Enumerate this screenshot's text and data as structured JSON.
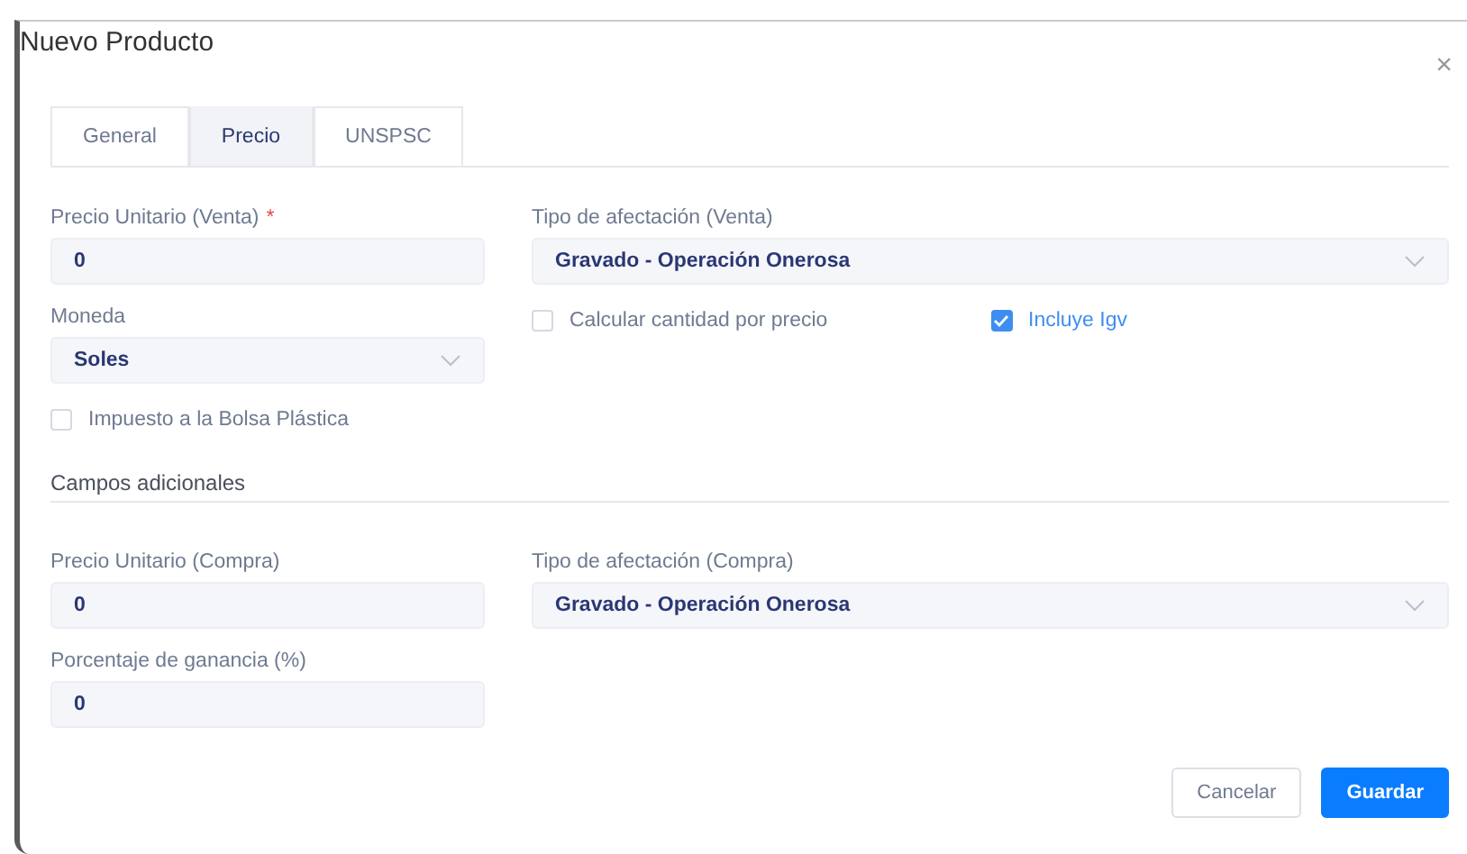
{
  "dialog": {
    "title": "Nuevo Producto",
    "close": "×"
  },
  "tabs": [
    {
      "label": "General",
      "selected": false
    },
    {
      "label": "Precio",
      "selected": true
    },
    {
      "label": "UNSPSC",
      "selected": false
    }
  ],
  "main_rows": [
    [
      {
        "kind": "input",
        "label": "Precio Unitario (Venta)",
        "required_mark": "*",
        "value": "0"
      },
      {
        "kind": "select",
        "label": "Tipo de afectación (Venta)",
        "value": "Gravado - Operación Onerosa"
      }
    ],
    [
      {
        "kind": "select",
        "label": "Moneda",
        "value": "Soles"
      },
      {
        "kind": "checks",
        "items": [
          {
            "label": "Calcular cantidad por precio",
            "checked": false
          },
          {
            "label": "Incluye Igv",
            "checked": true
          }
        ]
      }
    ],
    [
      {
        "kind": "checks",
        "items": [
          {
            "label": "Impuesto a la Bolsa Plástica",
            "checked": false
          }
        ]
      }
    ]
  ],
  "section_title": "Campos adicionales",
  "extra_rows": [
    [
      {
        "kind": "input",
        "label": "Precio Unitario (Compra)",
        "value": "0"
      },
      {
        "kind": "select",
        "label": "Tipo de afectación (Compra)",
        "value": "Gravado - Operación Onerosa"
      }
    ],
    [
      {
        "kind": "input",
        "label": "Porcentaje de ganancia (%)",
        "value": "0"
      }
    ]
  ],
  "buttons": [
    {
      "label": "Cancelar",
      "kind": "secondary"
    },
    {
      "label": "Guardar",
      "kind": "primary"
    }
  ]
}
